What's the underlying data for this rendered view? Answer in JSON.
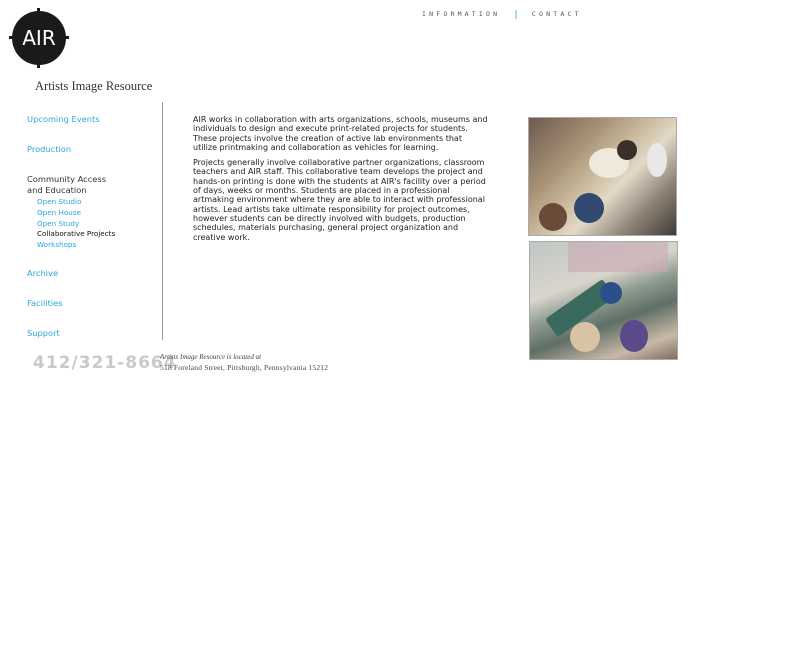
{
  "logo": {
    "text": "AIR"
  },
  "org_name": "Artists Image Resource",
  "topnav": {
    "information": "INFORMATION",
    "separator": "|",
    "contact": "CONTACT"
  },
  "sidebar": {
    "upcoming_events": "Upcoming Events",
    "production": "Production",
    "community_line1": "Community Access",
    "community_line2": "and Education",
    "subitems": [
      {
        "label": "Open Studio"
      },
      {
        "label": "Open House"
      },
      {
        "label": "Open Study"
      },
      {
        "label": "Collaborative Projects"
      },
      {
        "label": "Workshops"
      }
    ],
    "archive": "Archive",
    "facilities": "Facilities",
    "support": "Support"
  },
  "content": {
    "paragraph1": "AIR works in collaboration with arts organizations, schools, museums and individuals to design and execute print-related projects for students. These projects involve the creation of active lab environments that utilize printmaking and collaboration as vehicles for learning.",
    "paragraph2": "Projects generally involve collaborative partner organizations, classroom teachers and AIR staff. This collaborative team develops the project and hands-on printing is done with the students at AIR's facility over a period of days, weeks or months. Students are placed in a professional artmaking environment where they are able to interact with professional artists. Lead artists take ultimate responsibility for project outcomes, however students can be directly involved with budgets, production schedules, materials purchasing, general project organization and creative work."
  },
  "footer": {
    "phone": "412/321-8664",
    "address_line1": "Artists Image Resource is located at",
    "address_line2": "518 Foreland Street, Pittsburgh, Pennsylvania 15212"
  },
  "colors": {
    "link": "#2aa7dd",
    "text": "#222222",
    "phone": "#c9c9c9"
  }
}
